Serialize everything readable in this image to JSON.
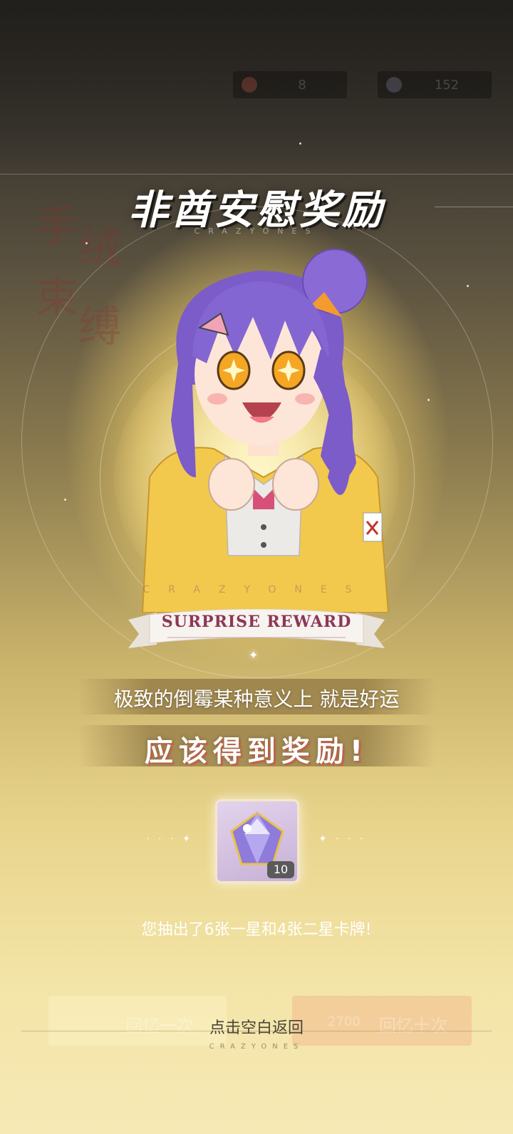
{
  "currency": [
    {
      "icon": "energy-icon",
      "value": "8"
    },
    {
      "icon": "gem-icon",
      "value": "152"
    }
  ],
  "background_text": [
    "手",
    "束",
    "绒",
    "缚"
  ],
  "title": {
    "text": "非酋安慰奖励",
    "sub": "CRAZYONES"
  },
  "character": {
    "label": "CRAZYONES"
  },
  "ribbon": {
    "text": "SURPRISE REWARD"
  },
  "messages": {
    "line1": "极致的倒霉某种意义上 就是好运",
    "line2": "应该得到奖励!"
  },
  "reward": {
    "icon": "crystal-icon",
    "count": "10",
    "left_decor": "· · · ✦",
    "right_decor": "✦ · · ·"
  },
  "result_text": "您抽出了6张一星和4张二星卡牌!",
  "background_buttons": [
    {
      "label": "回忆一次"
    },
    {
      "label": "回忆十次",
      "cost": "2700"
    }
  ],
  "footer": {
    "return_text": "点击空白返回",
    "brand": "CRAZYONES"
  },
  "colors": {
    "ribbon_text": "#8c3758",
    "glow": "#ffe9a0",
    "accent_shadow": "#d25046"
  }
}
